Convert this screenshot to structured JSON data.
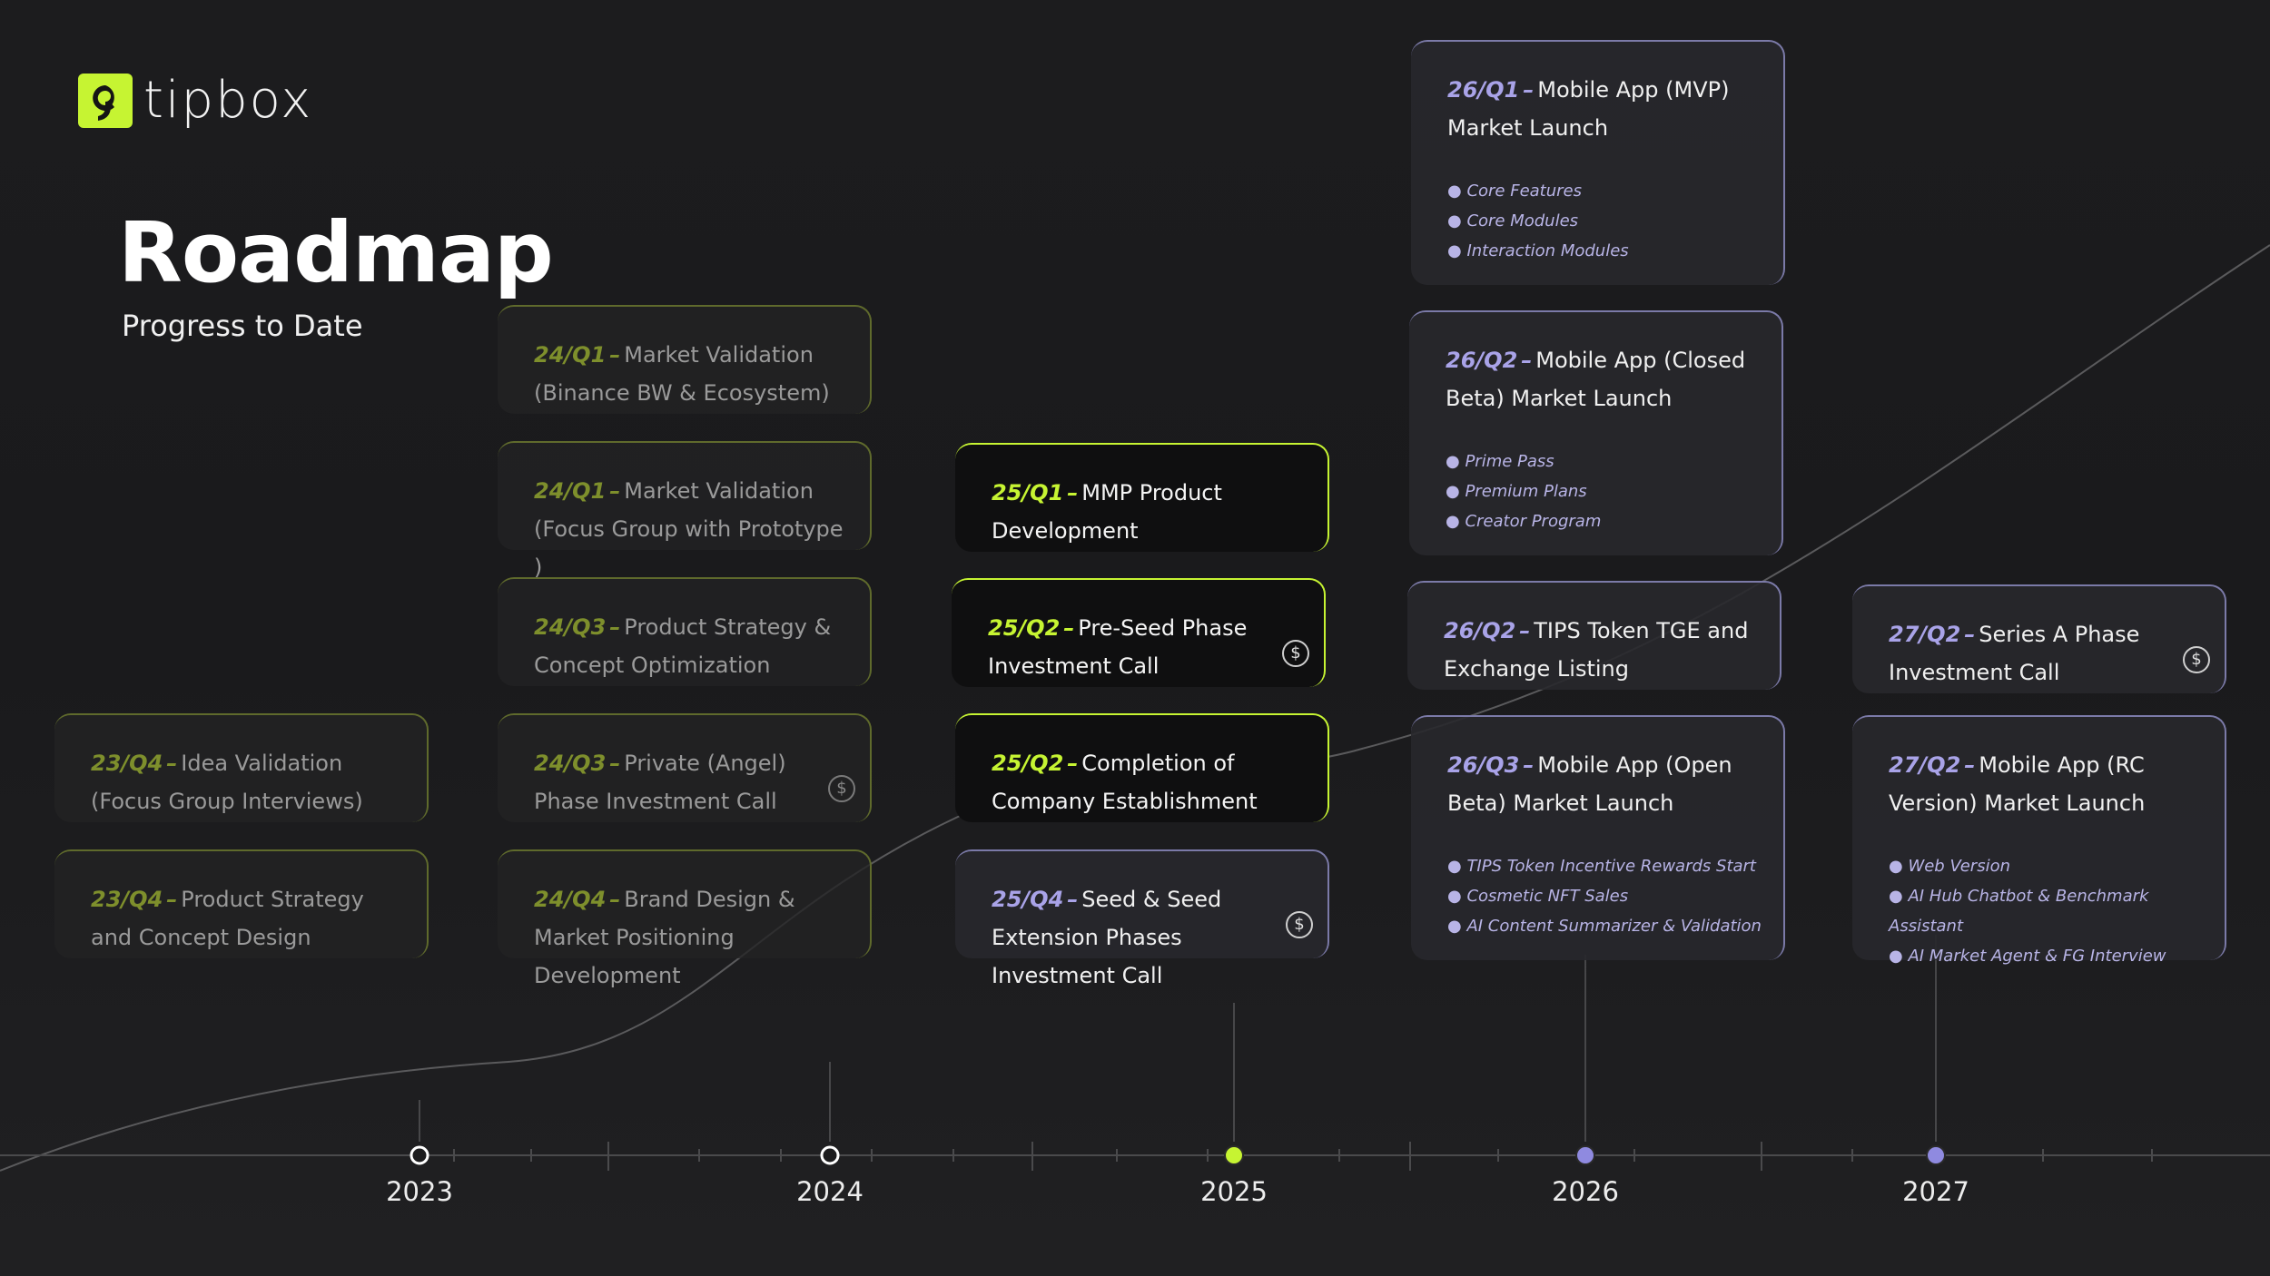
{
  "brand": {
    "name": "tipbox",
    "accent": "#c6f432",
    "secondary_accent": "#8f8ae0"
  },
  "header": {
    "title": "Roadmap",
    "subtitle": "Progress to Date"
  },
  "timeline": {
    "years": [
      "2023",
      "2024",
      "2025",
      "2026",
      "2027"
    ]
  },
  "cards": [
    {
      "q": "23/Q4",
      "text": "Idea Validation (Focus Group Interviews)"
    },
    {
      "q": "23/Q4",
      "text": "Product Strategy and Concept Design"
    },
    {
      "q": "24/Q1",
      "text": "Market Validation (Binance BW & Ecosystem)"
    },
    {
      "q": "24/Q1",
      "text": "Market Validation (Focus Group with Prototype )"
    },
    {
      "q": "24/Q3",
      "text": "Product Strategy & Concept Optimization"
    },
    {
      "q": "24/Q3",
      "text": "Private (Angel) Phase Investment Call",
      "icon": "dollar-icon"
    },
    {
      "q": "24/Q4",
      "text": "Brand Design & Market Positioning Development"
    },
    {
      "q": "25/Q1",
      "text": "MMP Product Development"
    },
    {
      "q": "25/Q2",
      "text": "Pre-Seed Phase Investment Call",
      "icon": "dollar-icon"
    },
    {
      "q": "25/Q2",
      "text": "Completion of Company Establishment"
    },
    {
      "q": "25/Q4",
      "text": "Seed & Seed Extension Phases Investment Call",
      "icon": "dollar-icon"
    },
    {
      "q": "26/Q1",
      "text": "Mobile App (MVP) Market Launch",
      "bullets": [
        "Core Features",
        "Core Modules",
        "Interaction Modules"
      ]
    },
    {
      "q": "26/Q2",
      "text": "Mobile App (Closed Beta) Market Launch",
      "bullets": [
        "Prime Pass",
        "Premium Plans",
        "Creator Program"
      ]
    },
    {
      "q": "26/Q2",
      "text": "TIPS Token TGE and Exchange Listing"
    },
    {
      "q": "26/Q3",
      "text": "Mobile App (Open Beta) Market Launch",
      "bullets": [
        "TIPS Token Incentive Rewards Start",
        "Cosmetic NFT Sales",
        "AI Content Summarizer & Validation"
      ]
    },
    {
      "q": "27/Q2",
      "text": "Series A Phase Investment Call",
      "icon": "dollar-icon"
    },
    {
      "q": "27/Q2",
      "text": "Mobile App (RC Version) Market Launch",
      "bullets": [
        "Web Version",
        "AI Hub Chatbot & Benchmark Assistant",
        "AI Market Agent & FG Interview"
      ]
    }
  ]
}
